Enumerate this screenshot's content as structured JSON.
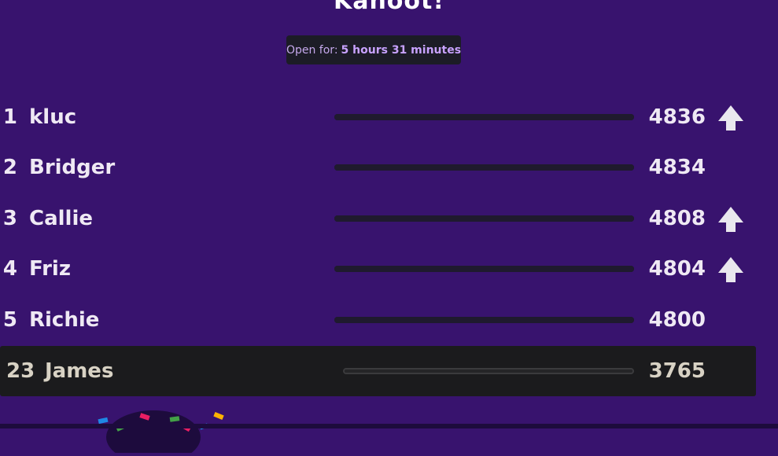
{
  "app": {
    "logo": "Kahoot!"
  },
  "timer": {
    "label": "Open for:",
    "value": "5 hours 31 minutes"
  },
  "leaderboard": [
    {
      "rank": "1",
      "name": "kluc",
      "score": "4836",
      "trend": "up",
      "progress": 1.0
    },
    {
      "rank": "2",
      "name": "Bridger",
      "score": "4834",
      "trend": "none",
      "progress": 1.0
    },
    {
      "rank": "3",
      "name": "Callie",
      "score": "4808",
      "trend": "up",
      "progress": 1.0
    },
    {
      "rank": "4",
      "name": "Friz",
      "score": "4804",
      "trend": "up",
      "progress": 1.0
    },
    {
      "rank": "5",
      "name": "Richie",
      "score": "4800",
      "trend": "none",
      "progress": 1.0
    }
  ],
  "current_player": {
    "rank": "23",
    "name": "James",
    "score": "3765",
    "progress": 1.0
  },
  "colors": {
    "background": "#38136e",
    "bar": "#1f1a2e",
    "highlight_row": "#1b1b1d",
    "text": "#efe9f4",
    "timer_accent": "#c8a2ff"
  },
  "icons": {
    "trend_up": "arrow-up-icon"
  }
}
